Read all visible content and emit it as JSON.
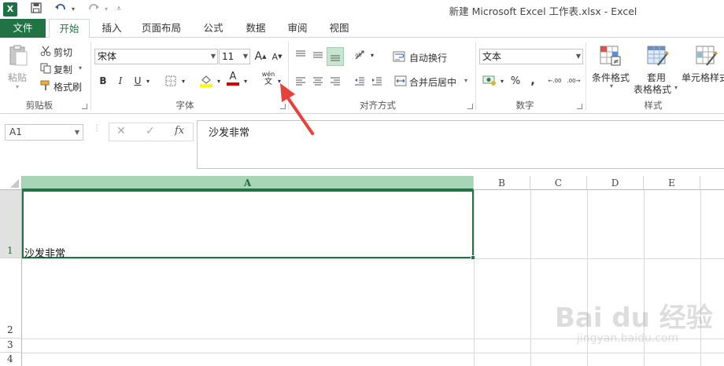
{
  "window": {
    "title": "新建 Microsoft Excel 工作表.xlsx - Excel",
    "app_logo": "X"
  },
  "quick_access": {
    "save_icon": "save-icon",
    "undo_icon": "undo-icon",
    "redo_icon": "redo-icon",
    "customize_icon": "customize-icon"
  },
  "tabs": [
    "文件",
    "开始",
    "插入",
    "页面布局",
    "公式",
    "数据",
    "审阅",
    "视图"
  ],
  "active_tab": "开始",
  "ribbon": {
    "clipboard": {
      "paste": "粘贴",
      "cut": "剪切",
      "copy": "复制",
      "format_painter": "格式刷",
      "group": "剪贴板"
    },
    "font": {
      "font_name": "宋体",
      "font_size": "11",
      "grow": "A",
      "shrink": "A",
      "bold": "B",
      "italic": "I",
      "underline": "U",
      "font_color_letter": "A",
      "phonetic_top": "wén",
      "phonetic_bottom": "文",
      "group": "字体",
      "highlight_color": "#ffff00",
      "font_color": "#d40000"
    },
    "alignment": {
      "wrap_text": "自动换行",
      "merge_center": "合并后居中",
      "group": "对齐方式"
    },
    "number": {
      "format": "文本",
      "percent": "%",
      "comma": ",",
      "inc_decimal": "←.00",
      "dec_decimal": ".00→",
      "group": "数字"
    },
    "styles": {
      "conditional": "条件格式",
      "table_line1": "套用",
      "table_line2": "表格格式",
      "cell_styles": "单元格样式",
      "group": "样式"
    }
  },
  "formula_bar": {
    "name_box": "A1",
    "cancel": "✕",
    "enter": "✓",
    "fx": "fx",
    "content": "沙发非常"
  },
  "grid": {
    "columns": [
      "A",
      "B",
      "C",
      "D",
      "E"
    ],
    "rows": [
      "1",
      "2",
      "3",
      "4"
    ],
    "selected_cell_text": "沙发非常"
  },
  "watermark": {
    "main": "Bai du 经验",
    "url": "jingyan.baidu.com"
  },
  "colors": {
    "accent": "#217346",
    "selected_header": "#a8d5b5",
    "annotation_arrow": "#e8413a"
  }
}
